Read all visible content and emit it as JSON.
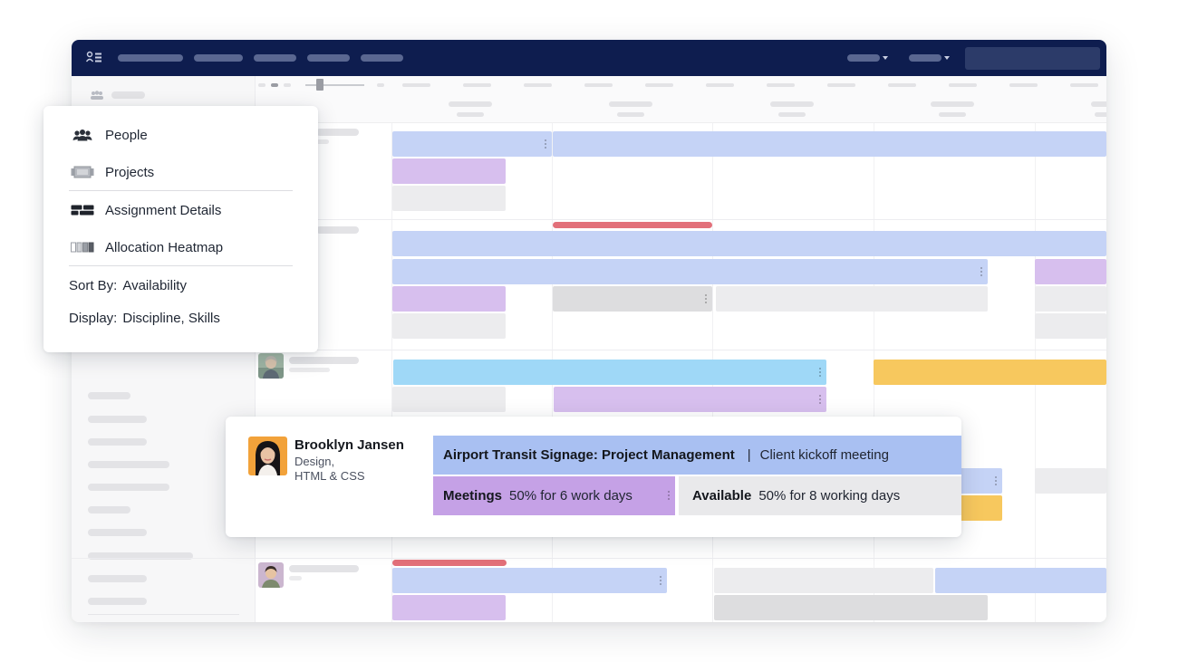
{
  "menu": {
    "items": [
      {
        "label": "People",
        "icon": "people-icon"
      },
      {
        "label": "Projects",
        "icon": "projects-icon"
      },
      {
        "label": "Assignment Details",
        "icon": "assignment-details-icon"
      },
      {
        "label": "Allocation Heatmap",
        "icon": "heatmap-icon"
      }
    ],
    "sort_by_label": "Sort By:",
    "sort_by_value": "Availability",
    "display_label": "Display:",
    "display_value": "Discipline, Skills"
  },
  "assignment_card": {
    "person_name": "Brooklyn Jansen",
    "discipline_line1": "Design,",
    "discipline_line2": "HTML & CSS",
    "project_name": "Airport Transit Signage: Project Management",
    "separator": "|",
    "phase": "Client kickoff meeting",
    "meetings_label": "Meetings",
    "meetings_value": "50% for 6 work days",
    "available_label": "Available",
    "available_value": "50% for 8 working days"
  },
  "colors": {
    "topbar": "#0e1d4f",
    "assignment_blue": "#c5d3f6",
    "assignment_purple": "#d7bfee",
    "assignment_cyan": "#9fd8f7",
    "assignment_yellow": "#f7c85e",
    "overbooked_red": "#e2707a",
    "project_bar": "#a9c0f2",
    "meetings_bar": "#c5a1e6"
  }
}
